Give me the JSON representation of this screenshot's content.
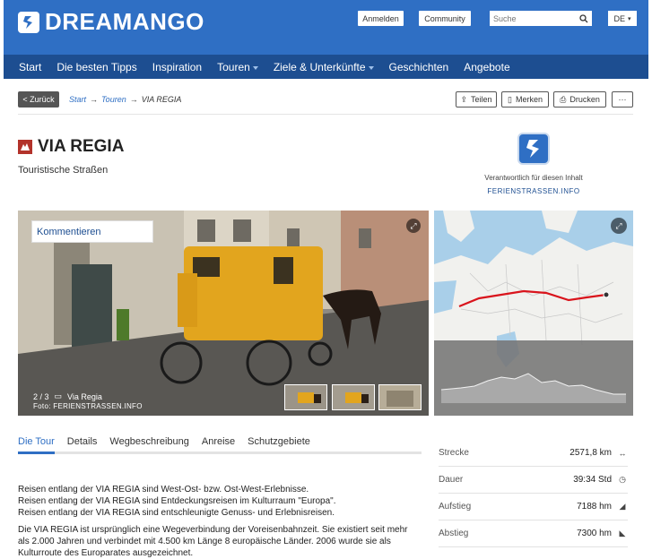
{
  "brand": {
    "name": "DREAMANGO",
    "color": "#2f6fc4",
    "nav_color": "#1d4e91"
  },
  "header": {
    "login": "Anmelden",
    "community": "Community",
    "search_placeholder": "Suche",
    "language": "DE"
  },
  "nav": [
    "Start",
    "Die besten Tipps",
    "Inspiration",
    "Touren",
    "Ziele & Unterkünfte",
    "Geschichten",
    "Angebote"
  ],
  "breadcrumb": {
    "back": "< Zurück",
    "items": [
      "Start",
      "Touren",
      "VIA REGIA"
    ],
    "sep": "→"
  },
  "actions": {
    "share": "Teilen",
    "save": "Merken",
    "print": "Drucken",
    "more": "···"
  },
  "page": {
    "title": "VIA REGIA",
    "subtitle": "Touristische Straßen",
    "responsible_label": "Verantwortlich für diesen Inhalt",
    "responsible_org": "FERIENSTRASSEN.INFO"
  },
  "gallery": {
    "comment": "Kommentieren",
    "counter": "2 / 3",
    "caption": "Via Regia",
    "credit": "Foto: FERIENSTRASSEN.INFO"
  },
  "tabs": [
    "Die Tour",
    "Details",
    "Wegbeschreibung",
    "Anreise",
    "Schutzgebiete"
  ],
  "description": [
    "Reisen entlang der VIA REGIA sind West-Ost- bzw. Ost-West-Erlebnisse.\nReisen entlang der VIA REGIA sind Entdeckungsreisen im Kulturraum \"Europa\".\nReisen entlang der VIA REGIA sind entschleunigte Genuss- und Erlebnisreisen.",
    "Die VIA REGIA ist ursprünglich eine Wegeverbindung der Voreisenbahnzeit. Sie existiert seit mehr als 2.000 Jahren und verbindet mit 4.500 km Länge 8 europäische Länder. 2006 wurde sie als Kulturroute des Europarates ausgezeichnet."
  ],
  "stats": [
    {
      "label": "Strecke",
      "value": "2571,8 km",
      "icon": "distance-icon"
    },
    {
      "label": "Dauer",
      "value": "39:34 Std",
      "icon": "clock-icon"
    },
    {
      "label": "Aufstieg",
      "value": "7188 hm",
      "icon": "ascent-icon"
    },
    {
      "label": "Abstieg",
      "value": "7300 hm",
      "icon": "descent-icon"
    }
  ],
  "route_color": "#d9141c"
}
